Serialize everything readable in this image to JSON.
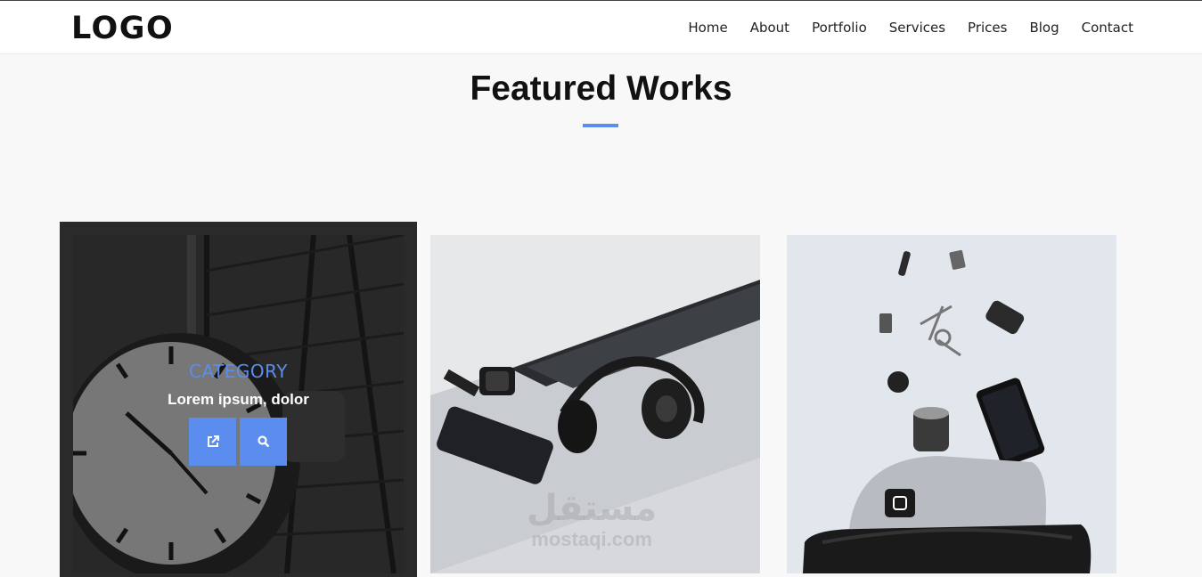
{
  "header": {
    "logo": "LOGO",
    "nav": [
      "Home",
      "About",
      "Portfolio",
      "Services",
      "Prices",
      "Blog",
      "Contact"
    ]
  },
  "section": {
    "title": "Featured Works",
    "accent_color": "#5b8def"
  },
  "portfolio": {
    "items": [
      {
        "image": "station-clock-photo",
        "category": "CATEGORY",
        "title": "Lorem ipsum, dolor",
        "buttons": [
          "external-link-icon",
          "search-icon"
        ],
        "hovered": true
      },
      {
        "image": "headphones-laptop-phone-photo"
      },
      {
        "image": "bag-keys-phone-camera-photo"
      }
    ]
  },
  "watermark": {
    "arabic": "مستقل",
    "latin": "mostaqi.com"
  }
}
